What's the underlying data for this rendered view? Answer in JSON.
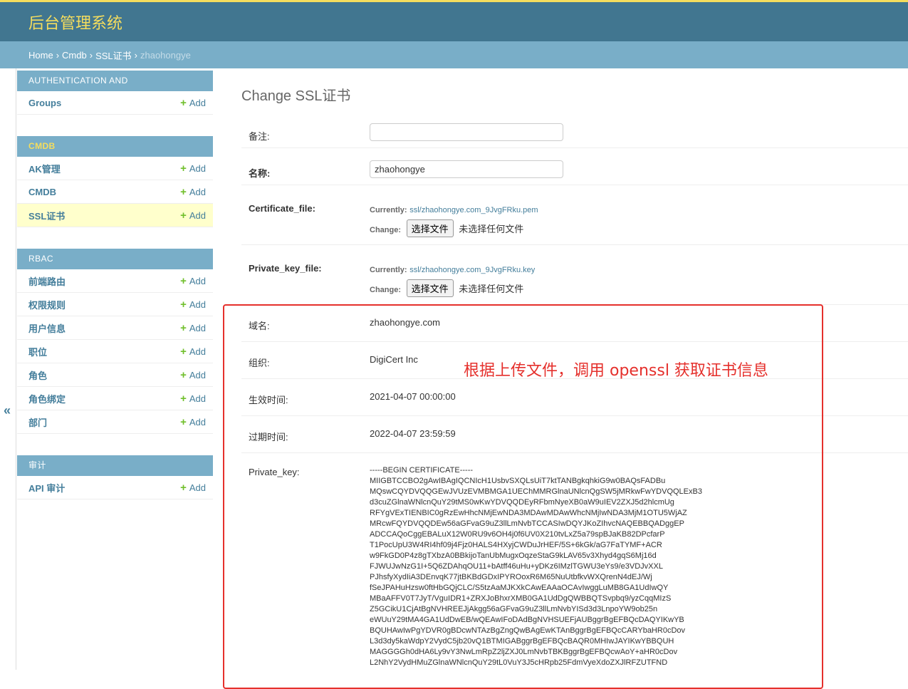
{
  "header": {
    "brand": "后台管理系统"
  },
  "breadcrumb": {
    "home": "Home",
    "app": "Cmdb",
    "model": "SSL证书",
    "current": "zhaohongye",
    "sep": "›"
  },
  "sidebar_toggle": "«",
  "sidebar": {
    "add_label": "Add",
    "modules": [
      {
        "title": "AUTHENTICATION AND AUTHORIZATION",
        "items": [
          "Groups"
        ]
      },
      {
        "title": "CMDB",
        "items": [
          "AK管理",
          "CMDB",
          "SSL证书"
        ]
      },
      {
        "title": "RBAC",
        "items": [
          "前端路由",
          "权限规则",
          "用户信息",
          "职位",
          "角色",
          "角色绑定",
          "部门"
        ]
      },
      {
        "title": "审计",
        "items": [
          "API 审计"
        ]
      }
    ]
  },
  "page_title": "Change SSL证书",
  "form": {
    "remark_label": "备注:",
    "remark_value": "",
    "name_label": "名称:",
    "name_value": "zhaohongye",
    "currently_label": "Currently:",
    "change_label": "Change:",
    "choose_file": "选择文件",
    "no_file": "未选择任何文件",
    "cert_file_label": "Certificate_file:",
    "cert_file_link": "ssl/zhaohongye.com_9JvgFRku.pem",
    "key_file_label": "Private_key_file:",
    "key_file_link": "ssl/zhaohongye.com_9JvgFRku.key",
    "domain_label": "域名:",
    "domain_value": "zhaohongye.com",
    "org_label": "组织:",
    "org_value": "DigiCert Inc",
    "start_label": "生效时间:",
    "start_value": "2021-04-07 00:00:00",
    "end_label": "过期时间:",
    "end_value": "2022-04-07 23:59:59",
    "pk_label": "Private_key:",
    "pk_lines": [
      "-----BEGIN CERTIFICATE-----",
      "MIIGBTCCBO2gAwIBAgIQCNIcH1UsbvSXQLsUiT7ktTANBgkqhkiG9w0BAQsFADBu",
      "MQswCQYDVQQGEwJVUzEVMBMGA1UEChMMRGlnaUNlcnQgSW5jMRkwFwYDVQQLExB3",
      "d3cuZGlnaWNlcnQuY29tMS0wKwYDVQQDEyRFbmNyeXB0aW9uIEV2ZXJ5d2hlcmUg",
      "RFYgVExTIENBIC0gRzEwHhcNMjEwNDA3MDAwMDAwWhcNMjIwNDA3MjM1OTU5WjAZ",
      "MRcwFQYDVQQDEw56aGFvaG9uZ3llLmNvbTCCASIwDQYJKoZIhvcNAQEBBQADggEP",
      "ADCCAQoCggEBALuX12W0RU9v6OH4j0f6UV0X210tvLxZ5a79spBJaKB82DPcfarP",
      "T1PocUpU3W4RI4hf09j4Fjz0HALS4HXyjCWDuJrHEF/5S+6kGk/aG7FaTYMF+ACR",
      "w9FkGD0P4z8gTXbzA0BBkijoTanUbMugxOqzeStaG9kLAV65v3Xhyd4gqS6Mj16d",
      "FJWUJwNzG1I+5Q6ZDAhqOU11+bAtff46uHu+yDKz6IMzlTGWU3eYs9/e3VDJvXXL",
      "PJhsfyXydIiA3DEnvqK77jtBKBdGDxIPYROoxR6M65NuUtbfkvWXQrenN4dEJ/Wj",
      "fSeJPAHuHzsw0ftHbGQjCLC/S5tzAaMJKXkCAwEAAaOCAvIwggLuMB8GA1UdIwQY",
      "MBaAFFV0T7JyT/VguIDR1+ZRXJoBhxrXMB0GA1UdDgQWBBQTSvpbq9/yzCqqMIzS",
      "Z5GCikU1CjAtBgNVHREEJjAkgg56aGFvaG9uZ3llLmNvbYISd3d3LnpoYW9ob25n",
      "eWUuY29tMA4GA1UdDwEB/wQEAwIFoDAdBgNVHSUEFjAUBggrBgEFBQcDAQYIKwYB",
      "BQUHAwIwPgYDVR0gBDcwNTAzBgZngQwBAgEwKTAnBggrBgEFBQcCARYbaHR0cDov",
      "L3d3dy5kaWdpY2VydC5jb20vQ1BTMIGABggrBgEFBQcBAQR0MHIwJAYIKwYBBQUH",
      "MAGGGGh0dHA6Ly9vY3NwLmRpZ2ljZXJ0LmNvbTBKBggrBgEFBQcwAoY+aHR0cDov",
      "L2NhY2VydHMuZGlnaWNlcnQuY29tL0VuY3J5cHRpb25FdmVyeXdoZXJlRFZUTFND"
    ]
  },
  "annotation": "根据上传文件，调用 openssl 获取证书信息"
}
